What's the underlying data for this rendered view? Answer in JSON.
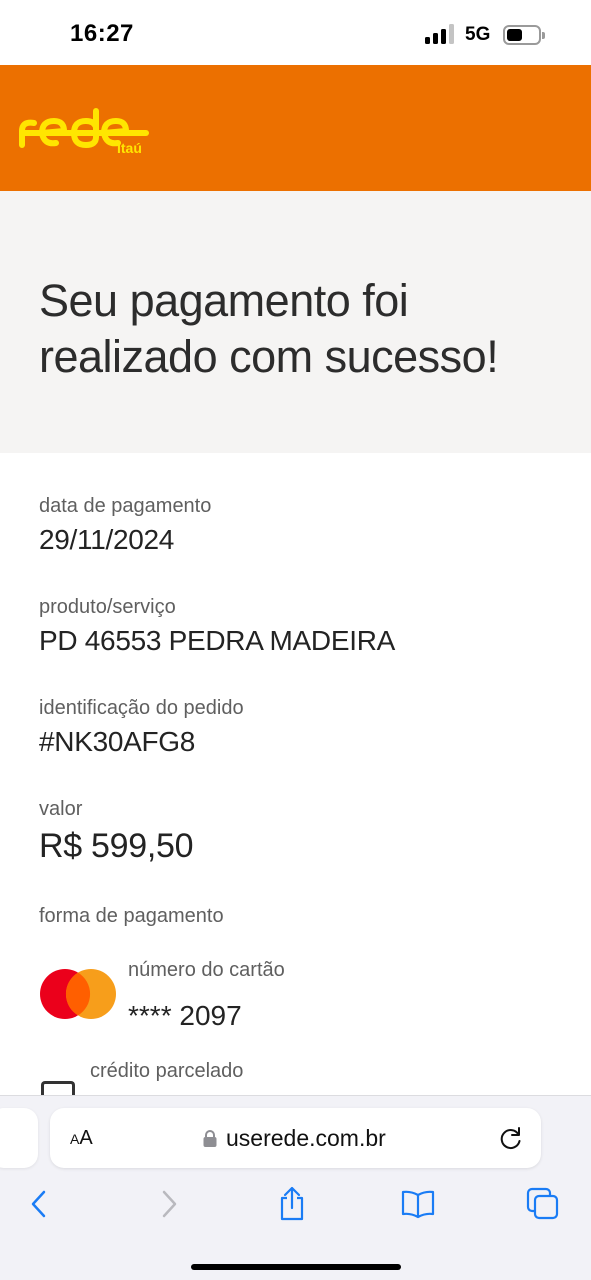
{
  "status_bar": {
    "time": "16:27",
    "network": "5G",
    "signal_bars": 3,
    "battery_level": 0.45
  },
  "brand": {
    "name": "rede",
    "sub": "Itaú",
    "header_color": "#ec7000",
    "logo_color": "#ffe600"
  },
  "hero": {
    "title": "Seu pagamento foi realizado com sucesso!"
  },
  "details": {
    "payment_date_label": "data de pagamento",
    "payment_date_value": "29/11/2024",
    "product_label": "produto/serviço",
    "product_value": "PD 46553 PEDRA MADEIRA",
    "order_id_label": "identificação do pedido",
    "order_id_value": "#NK30AFG8",
    "amount_label": "valor",
    "amount_value": "R$ 599,50",
    "payment_method_label": "forma de pagamento",
    "card_number_label": "número do cartão",
    "card_number_value": "**** 2097",
    "card_brand_icon": "mastercard-icon",
    "installments_label": "crédito parcelado"
  },
  "browser": {
    "text_size_label": "AA",
    "url": "userede.com.br",
    "toolbar": [
      "back-icon",
      "forward-icon",
      "share-icon",
      "bookmarks-icon",
      "tabs-icon"
    ],
    "accent_color": "#1a7cf5"
  }
}
